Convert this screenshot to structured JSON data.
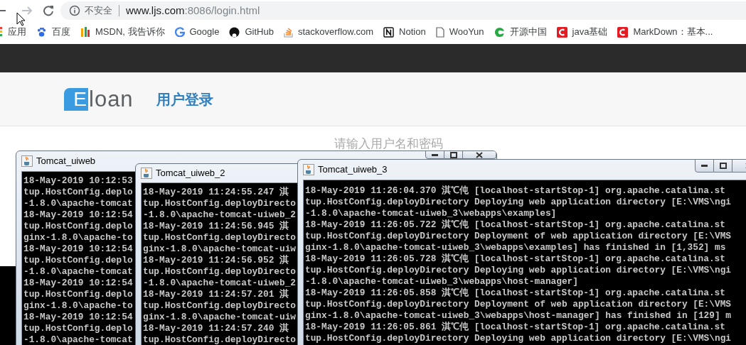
{
  "browser": {
    "security_label": "不安全",
    "url_host": "www.ljs.com",
    "url_rest": ":8086/login.html"
  },
  "bookmarks": [
    "应用",
    "百度",
    "MSDN, 我告诉你",
    "Google",
    "GitHub",
    "stackoverflow.com",
    "Notion",
    "WooYun",
    "开源中国",
    "java基础",
    "MarkDown：基本..."
  ],
  "page": {
    "logo_mark": "E",
    "logo_text": "loan",
    "title": "用户登录",
    "hint": "请输入用户名和密码"
  },
  "windows": [
    {
      "title": "Tomcat_uiweb",
      "lines": [
        "18-May-2019 10:12:53",
        "tup.HostConfig.deplo",
        "-1.8.0\\apache-tomcat",
        "18-May-2019 10:12:54",
        "tup.HostConfig.deplo",
        "ginx-1.8.0\\apache-to",
        "18-May-2019 10:12:54",
        "tup.HostConfig.deplo",
        "-1.8.0\\apache-tomcat",
        "18-May-2019 10:12:54",
        "tup.HostConfig.deplo",
        "ginx-1.8.0\\apache-to",
        "18-May-2019 10:12:54",
        "tup.HostConfig.deplo",
        "-1.8.0\\apache-tomcat"
      ]
    },
    {
      "title": "Tomcat_uiweb_2",
      "lines": [
        "18-May-2019 11:24:55.247 淇",
        "tup.HostConfig.deployDirecto",
        "-1.8.0\\apache-tomcat-uiweb_2",
        "18-May-2019 11:24:56.945 淇",
        "tup.HostConfig.deployDirecto",
        "ginx-1.8.0\\apache-tomcat-uiw",
        "18-May-2019 11:24:56.952 淇",
        "tup.HostConfig.deployDirecto",
        "-1.8.0\\apache-tomcat-uiweb_2",
        "18-May-2019 11:24:57.201 淇",
        "tup.HostConfig.deployDirecto",
        "ginx-1.8.0\\apache-tomcat-uiw",
        "18-May-2019 11:24:57.240 淇",
        "tup.HostConfig.deployDirecto"
      ]
    },
    {
      "title": "Tomcat_uiweb_3",
      "lines": [
        "18-May-2019 11:26:04.370 淇℃伅 [localhost-startStop-1] org.apache.catalina.st",
        "tup.HostConfig.deployDirectory Deploying web application directory [E:\\VMS\\ngi",
        "-1.8.0\\apache-tomcat-uiweb_3\\webapps\\examples]",
        "18-May-2019 11:26:05.722 淇℃伅 [localhost-startStop-1] org.apache.catalina.st",
        "tup.HostConfig.deployDirectory Deployment of web application directory [E:\\VMS",
        "ginx-1.8.0\\apache-tomcat-uiweb_3\\webapps\\examples] has finished in [1,352] ms",
        "18-May-2019 11:26:05.728 淇℃伅 [localhost-startStop-1] org.apache.catalina.st",
        "tup.HostConfig.deployDirectory Deploying web application directory [E:\\VMS\\ngi",
        "-1.8.0\\apache-tomcat-uiweb_3\\webapps\\host-manager]",
        "18-May-2019 11:26:05.858 淇℃伅 [localhost-startStop-1] org.apache.catalina.st",
        "tup.HostConfig.deployDirectory Deployment of web application directory [E:\\VMS",
        "ginx-1.8.0\\apache-tomcat-uiweb_3\\webapps\\host-manager] has finished in [129] m",
        "18-May-2019 11:26:05.861 淇℃伅 [localhost-startStop-1] org.apache.catalina.st",
        "tup.HostConfig.deployDirectory Deploying web application directory [E:\\VMS\\ngi"
      ]
    }
  ]
}
